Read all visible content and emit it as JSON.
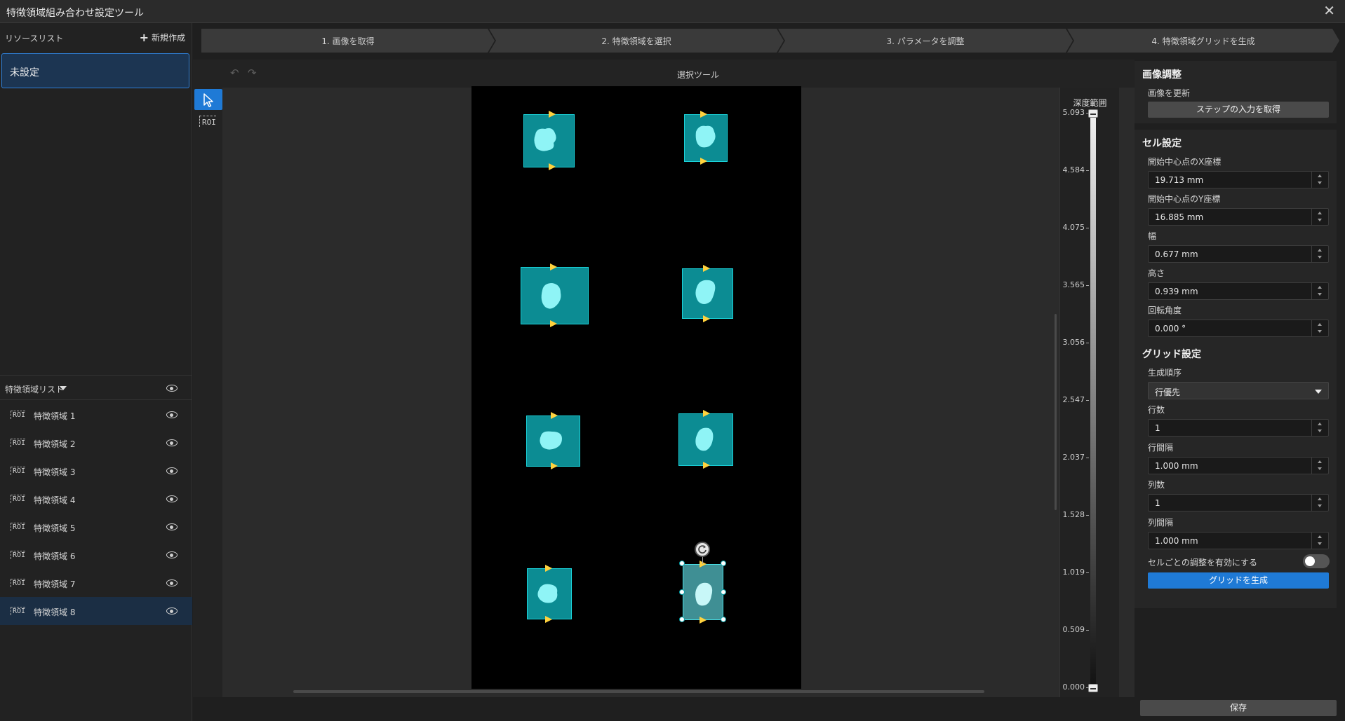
{
  "window": {
    "title": "特徴領域組み合わせ設定ツール"
  },
  "resources": {
    "header": "リソースリスト",
    "new_label": "新規作成",
    "items": [
      "未設定"
    ]
  },
  "steps": [
    "1. 画像を取得",
    "2. 特徴領域を選択",
    "3. パラメータを調整",
    "4. 特徴領域グリッドを生成"
  ],
  "toolbar": {
    "title": "選択ツール"
  },
  "tools": {
    "roi_label": "ROI"
  },
  "features": {
    "header": "特徴領域リスト",
    "items": [
      "特徴領域 1",
      "特徴領域 2",
      "特徴領域 3",
      "特徴領域 4",
      "特徴領域 5",
      "特徴領域 6",
      "特徴領域 7",
      "特徴領域 8"
    ],
    "selected_index": 7
  },
  "depth": {
    "title": "深度範囲",
    "ticks": [
      "5.093",
      "4.584",
      "4.075",
      "3.565",
      "3.056",
      "2.547",
      "2.037",
      "1.528",
      "1.019",
      "0.509",
      "0.000"
    ]
  },
  "image_adjust": {
    "title": "画像調整",
    "refresh_label": "画像を更新",
    "fetch_button": "ステップの入力を取得"
  },
  "cell": {
    "title": "セル設定",
    "fields": [
      {
        "label": "開始中心点のX座標",
        "value": "19.713 mm"
      },
      {
        "label": "開始中心点のY座標",
        "value": "16.885 mm"
      },
      {
        "label": "幅",
        "value": "0.677 mm"
      },
      {
        "label": "高さ",
        "value": "0.939 mm"
      },
      {
        "label": "回転角度",
        "value": "0.000 °"
      }
    ]
  },
  "grid": {
    "title": "グリッド設定",
    "order_label": "生成順序",
    "order_value": "行優先",
    "fields": [
      {
        "label": "行数",
        "value": "1"
      },
      {
        "label": "行間隔",
        "value": "1.000 mm"
      },
      {
        "label": "列数",
        "value": "1"
      },
      {
        "label": "列間隔",
        "value": "1.000 mm"
      }
    ],
    "per_cell_label": "セルごとの調整を有効にする",
    "per_cell_enabled": false,
    "generate_button": "グリッドを生成"
  },
  "save_button": "保存",
  "colors": {
    "accent": "#1f7ad6",
    "roi_fill": "#0c8c93",
    "roi_border": "#1ad3da",
    "arrow": "#ffd23e"
  }
}
